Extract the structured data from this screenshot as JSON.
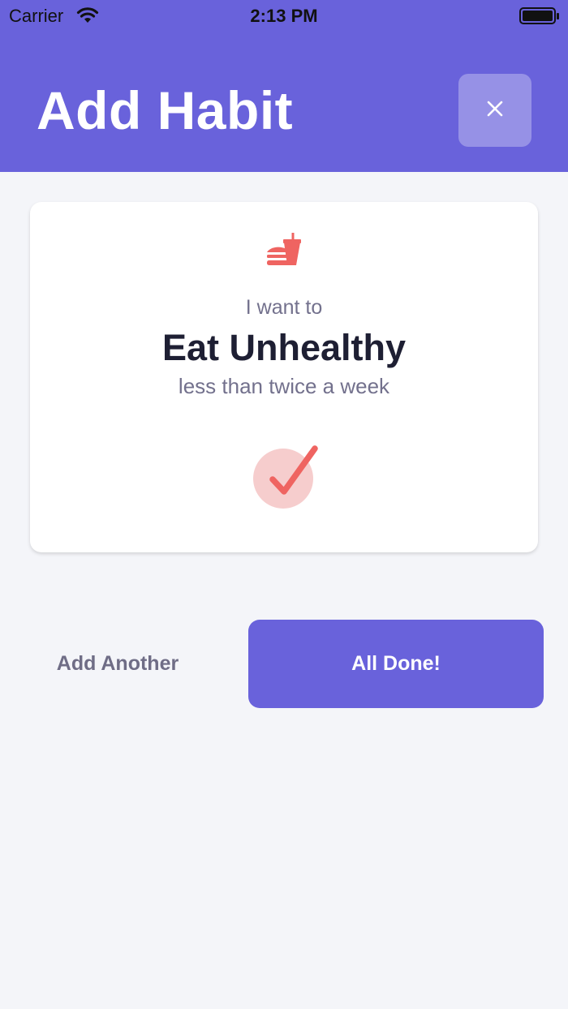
{
  "status_bar": {
    "carrier": "Carrier",
    "time": "2:13 PM",
    "wifi_icon": "wifi-icon",
    "battery_icon": "battery-full-icon"
  },
  "header": {
    "title": "Add Habit",
    "close_icon": "close-icon",
    "background_color": "#6962db"
  },
  "card": {
    "icon": "fast-food-icon",
    "intro": "I want to",
    "habit": "Eat Unhealthy",
    "frequency": "less than twice a week",
    "status_icon": "checkmark-icon",
    "accent_color": "#ef6461"
  },
  "actions": {
    "add_another_label": "Add Another",
    "done_label": "All Done!"
  }
}
